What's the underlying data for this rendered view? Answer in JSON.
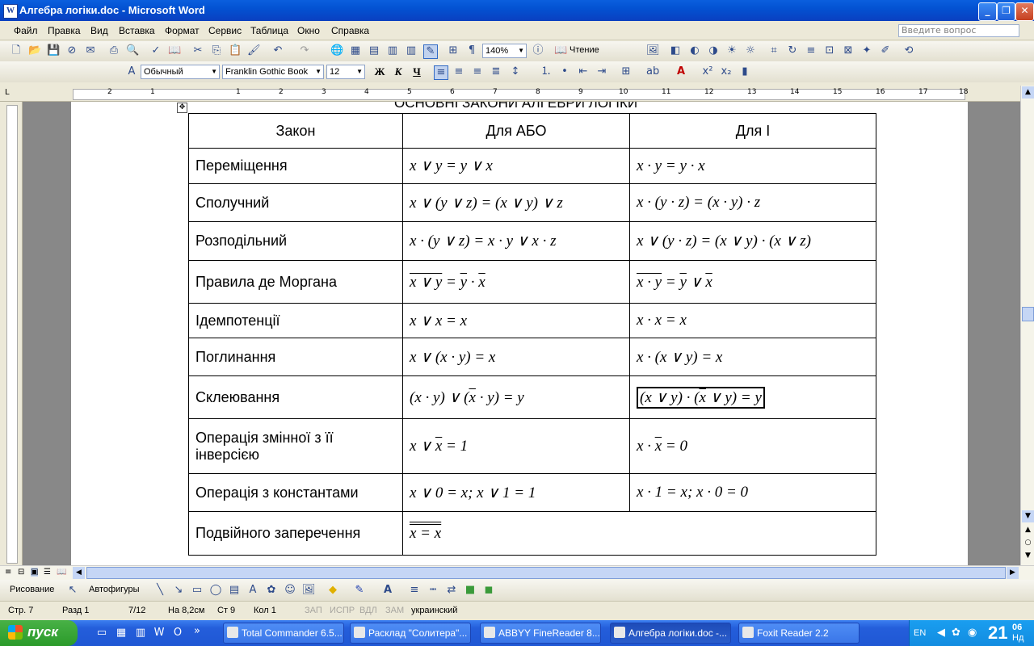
{
  "window": {
    "title": "Алгебра логіки.doc - Microsoft Word"
  },
  "menu": {
    "items": [
      "Файл",
      "Правка",
      "Вид",
      "Вставка",
      "Формат",
      "Сервис",
      "Таблица",
      "Окно",
      "Справка"
    ],
    "ask_placeholder": "Введите вопрос"
  },
  "toolbar": {
    "zoom": "140%",
    "read_label": "Чтение",
    "style": "Обычный",
    "font": "Franklin Gothic Book",
    "size": "12",
    "bold": "Ж",
    "italic": "К",
    "underline": "Ч"
  },
  "ruler": {
    "numbers": [
      "2",
      "1",
      "1",
      "2",
      "3",
      "4",
      "5",
      "6",
      "7",
      "8",
      "9",
      "10",
      "11",
      "12",
      "13",
      "14",
      "15",
      "16",
      "17",
      "18"
    ]
  },
  "document": {
    "partial_heading": "ОСНОВНІ ЗАКОНИ АЛГЕБРИ ЛОГІКИ",
    "header": {
      "law": "Закон",
      "or": "Для   АБО",
      "and": "Для    І"
    },
    "rows": [
      {
        "law": "Переміщення",
        "or": "x ∨ y = y ∨ x",
        "and": "x · y =  y · x"
      },
      {
        "law": "Сполучний",
        "or": "x ∨ (y ∨ z) = (x ∨ y) ∨ z",
        "and": "x · (y · z) = (x · y) · z"
      },
      {
        "law": "Розподільний",
        "or": "x · (y ∨ z) = x · y ∨ x · z",
        "and": "x ∨ (y · z) = (x ∨ y) · (x ∨ z)"
      },
      {
        "law": "Правила де Моргана",
        "or": "",
        "and": ""
      },
      {
        "law": "Ідемпотенції",
        "or": "x ∨ x = x",
        "and": "x · x = x"
      },
      {
        "law": "Поглинання",
        "or": "x ∨ (x · y) = x",
        "and": "x · (x ∨ y) = x"
      },
      {
        "law": "Склеювання",
        "or": "",
        "and": ""
      },
      {
        "law": "Операція змінної з її інверсією",
        "or": "",
        "and": ""
      },
      {
        "law": "Операція з константами",
        "or": "x ∨ 0 = x;  x ∨ 1 = 1",
        "and": "x · 1 = x;  x · 0 = 0"
      },
      {
        "law": "Подвійного заперечення",
        "or": "x = x",
        "and": ""
      }
    ]
  },
  "drawbar": {
    "draw": "Рисование",
    "autoshapes": "Автофигуры"
  },
  "status": {
    "page": "Стр. 7",
    "section": "Разд 1",
    "pages": "7/12",
    "at": "На 8,2см",
    "line": "Ст 9",
    "col": "Кол 1",
    "rec": "ЗАП",
    "trk": "ИСПР",
    "ext": "ВДЛ",
    "ovr": "ЗАМ",
    "lang": "украинский"
  },
  "taskbar": {
    "start": "пуск",
    "tasks": [
      "Total Commander 6.5...",
      "Расклад \"Солитера\"...",
      "ABBYY FineReader 8....",
      "Алгебра логіки.doc -...",
      "Foxit Reader 2.2"
    ],
    "lang": "EN",
    "time": "21",
    "time_min": "06",
    "day": "Нд"
  }
}
